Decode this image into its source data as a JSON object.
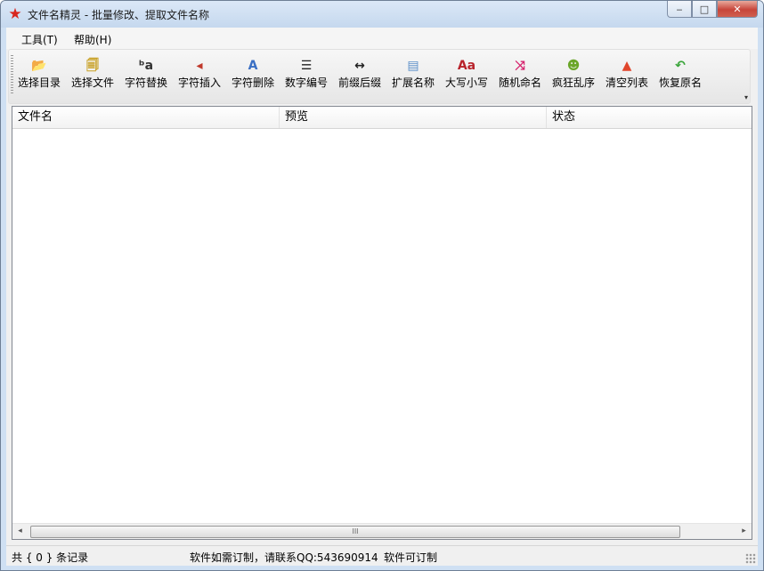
{
  "window": {
    "title": "文件名精灵 - 批量修改、提取文件名称",
    "icon": "star-icon",
    "controls": {
      "minimize": "‒",
      "maximize": "□",
      "close": "✕"
    }
  },
  "menu": {
    "tools": "工具(T)",
    "help": "帮助(H)"
  },
  "toolbar": {
    "buttons": [
      {
        "label": "选择目录",
        "icon": "open-folder-icon",
        "glyph": "📂",
        "color": "#d69a1c"
      },
      {
        "label": "选择文件",
        "icon": "files-icon",
        "glyph": "🗐",
        "color": "#c9a227"
      },
      {
        "label": "字符替换",
        "icon": "replace-icon",
        "glyph": "ᵇa",
        "color": "#333333"
      },
      {
        "label": "字符插入",
        "icon": "insert-icon",
        "glyph": "◂",
        "color": "#c0392b"
      },
      {
        "label": "字符删除",
        "icon": "delete-char-icon",
        "glyph": "A",
        "color": "#3a6fc4"
      },
      {
        "label": "数字编号",
        "icon": "numbered-list-icon",
        "glyph": "☰",
        "color": "#222222"
      },
      {
        "label": "前缀后缀",
        "icon": "prefix-suffix-icon",
        "glyph": "↔",
        "color": "#222222"
      },
      {
        "label": "扩展名称",
        "icon": "extension-icon",
        "glyph": "▤",
        "color": "#5b8fc9"
      },
      {
        "label": "大写小写",
        "icon": "case-icon",
        "glyph": "Aa",
        "color": "#b8232b"
      },
      {
        "label": "随机命名",
        "icon": "shuffle-icon",
        "glyph": "⤨",
        "color": "#d6246e"
      },
      {
        "label": "疯狂乱序",
        "icon": "crazy-face-icon",
        "glyph": "☻",
        "color": "#6aa629"
      },
      {
        "label": "清空列表",
        "icon": "eraser-icon",
        "glyph": "▲",
        "color": "#e0462c"
      },
      {
        "label": "恢复原名",
        "icon": "undo-icon",
        "glyph": "↶",
        "color": "#3aa53a"
      }
    ],
    "overflow": "▾"
  },
  "list": {
    "columns": [
      "文件名",
      "预览",
      "状态"
    ],
    "rows": []
  },
  "scrollbar": {
    "left": "◂",
    "right": "▸",
    "thumb": "III"
  },
  "status": {
    "count": "共 { 0 } 条记录",
    "contact": "软件如需订制，请联系QQ:543690914",
    "custom": "软件可订制"
  }
}
